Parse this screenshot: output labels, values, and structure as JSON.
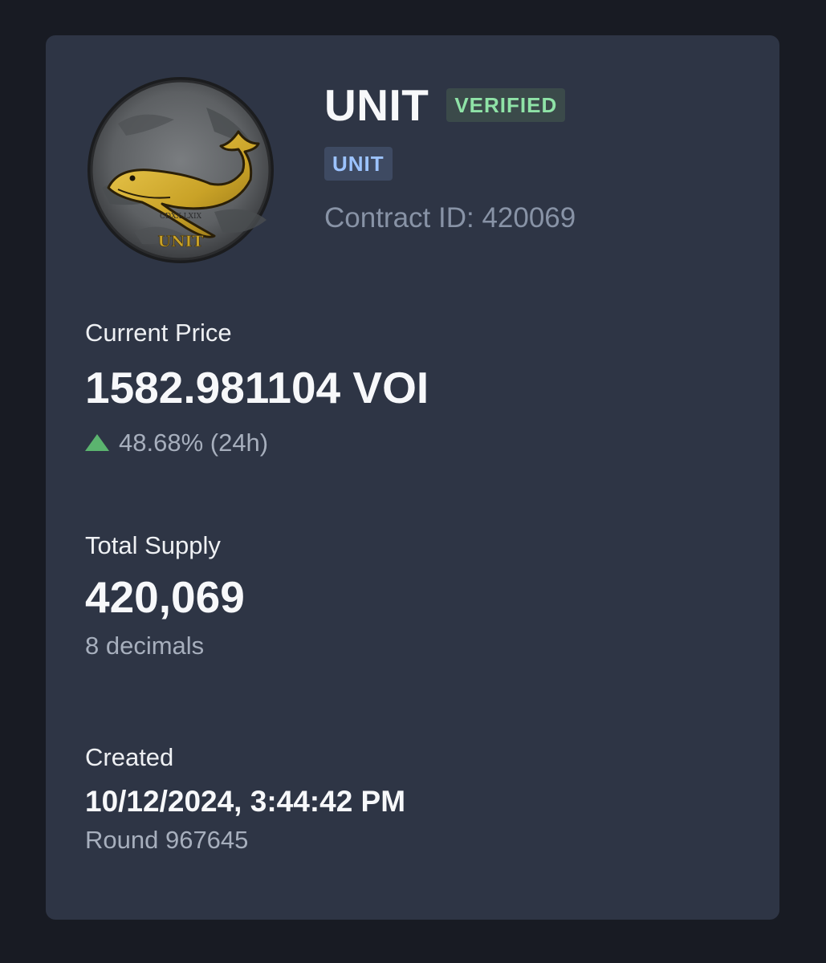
{
  "token": {
    "name": "UNIT",
    "verified_label": "VERIFIED",
    "symbol": "UNIT",
    "contract_id_text": "Contract ID: 420069",
    "logo_icon": "whale-coin-logo-icon",
    "logo_text": "UNIT",
    "logo_roman": "CDXX-LXIX"
  },
  "price": {
    "label": "Current Price",
    "value": "1582.981104 VOI",
    "change_icon": "up-triangle-icon",
    "change_text": "48.68% (24h)"
  },
  "supply": {
    "label": "Total Supply",
    "value": "420,069",
    "decimals_text": "8 decimals"
  },
  "created": {
    "label": "Created",
    "value": "10/12/2024, 3:44:42 PM",
    "round_text": "Round 967645"
  },
  "colors": {
    "page_background": "#181b23",
    "card_background": "#2e3545",
    "verified_badge_bg": "#3b4a4a",
    "verified_badge_text": "#8fe3a7",
    "symbol_badge_bg": "#3e4a62",
    "symbol_badge_text": "#9cc3ff",
    "price_up": "#5bb46f",
    "logo_gold": "#c9a227"
  }
}
